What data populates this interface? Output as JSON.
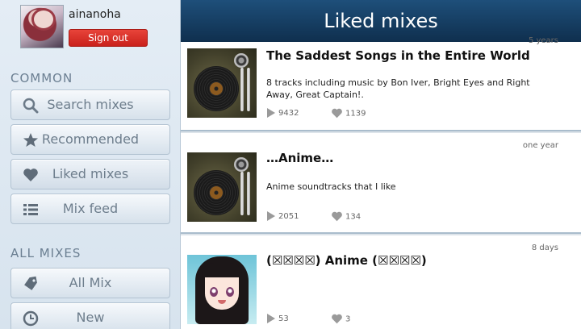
{
  "user": {
    "name": "ainanoha",
    "sign_out": "Sign out"
  },
  "sidebar": {
    "common_label": "COMMON",
    "common_items": [
      {
        "label": "Search mixes",
        "icon": "search-icon"
      },
      {
        "label": "Recommended",
        "icon": "star-icon"
      },
      {
        "label": "Liked mixes",
        "icon": "heart-icon"
      },
      {
        "label": "Mix feed",
        "icon": "list-icon"
      }
    ],
    "all_label": "ALL MIXES",
    "all_items": [
      {
        "label": "All Mix",
        "icon": "tag-icon"
      },
      {
        "label": "New",
        "icon": "clock-icon"
      }
    ]
  },
  "header": {
    "title": "Liked mixes"
  },
  "mixes": [
    {
      "title": "The Saddest Songs in the Entire World",
      "description": "8 tracks including music by Bon Iver, Bright Eyes and Right Away, Great Captain!.",
      "time": "5 years",
      "plays": "9432",
      "likes": "1139"
    },
    {
      "title": "…Anime…",
      "description": "Anime soundtracks that I like",
      "time": "one year",
      "plays": "2051",
      "likes": "134"
    },
    {
      "title": "(☒☒☒☒)  Anime (☒☒☒☒)",
      "description": "",
      "time": "8 days",
      "plays": "53",
      "likes": "3"
    }
  ],
  "colors": {
    "header": "#173f64",
    "signout": "#d9302a",
    "sidebar": "#dde8f1"
  }
}
